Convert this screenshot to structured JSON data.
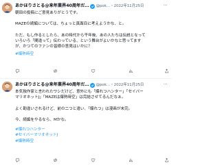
{
  "tweets": [
    {
      "author_name": "あかほりさとる@来年業界40周年だ…",
      "handle_time": "@pok…・2022年11月25日",
      "lines": [
        "朝田の投稿にご意見ありがとうです。",
        "",
        "MAZEの続編については、ちょっと真面目に考えようかな、と。",
        "",
        "ただ、もし作るとしたら、あの時代から干年後、あの人たちは伝説となって",
        "いろいろ「間違って」伝わっている、という舞台がよいかなと思ってます",
        "が、かつてのファンの皆様の意見はいかに？"
      ],
      "hashtags": [
        "#爆熱時空"
      ],
      "actions": {
        "reply": "",
        "retweet": "",
        "like": "",
        "views": ""
      }
    },
    {
      "author_name": "あかほりさとる@来年業界40周年だ…",
      "handle_time": "@pok…・2022年11月25日",
      "lines": [
        "本気独作家と言われたワシだけど、意外にも「爆れつハンター」「セイバー",
        "マリオネットJ」「MAZEは爆熱時空」は完結させてるんだなぁ。",
        "",
        "よく勘違いされるけど、前の二つと違い、「爆れつ」は漫画が未完。",
        "",
        "今、続編をやるなら、Mかな。"
      ],
      "hashtags": [
        "#爆れつハンター",
        "#セイバーマリオネットJ",
        "#爆熱時空"
      ],
      "actions": {
        "reply": "",
        "retweet": "",
        "like": "",
        "views": ""
      }
    }
  ],
  "colors": {
    "link": "#1d9bf0",
    "secondary_text": "#536471",
    "verified": "#1d9bf0"
  },
  "icons": [
    "avatar",
    "verified-badge-icon",
    "more-icon",
    "reply-icon",
    "retweet-icon",
    "like-icon",
    "views-icon",
    "share-icon"
  ]
}
